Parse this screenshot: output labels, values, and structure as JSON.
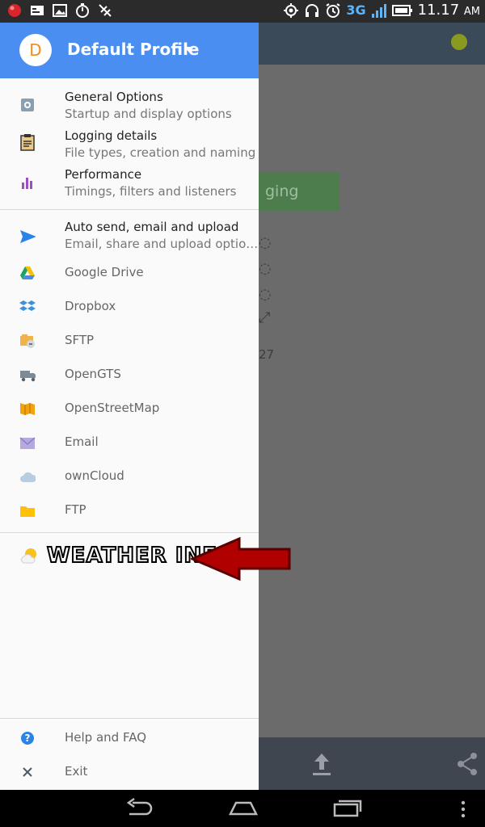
{
  "status_bar": {
    "network_label": "3G",
    "time": "11.17",
    "ampm": "AM"
  },
  "drawer": {
    "avatar_letter": "D",
    "profile_name": "Default Profile",
    "items_top": [
      {
        "title": "General Options",
        "subtitle": "Startup and display options",
        "icon": "gear-icon"
      },
      {
        "title": "Logging details",
        "subtitle": "File types, creation and naming",
        "icon": "clipboard-icon"
      },
      {
        "title": "Performance",
        "subtitle": "Timings, filters and listeners",
        "icon": "bar-chart-icon"
      }
    ],
    "auto_send": {
      "title": "Auto send, email and upload",
      "subtitle": "Email, share and upload optio…"
    },
    "services": [
      {
        "label": "Google Drive",
        "icon": "google-drive-icon"
      },
      {
        "label": "Dropbox",
        "icon": "dropbox-icon"
      },
      {
        "label": "SFTP",
        "icon": "sftp-icon"
      },
      {
        "label": "OpenGTS",
        "icon": "truck-icon"
      },
      {
        "label": "OpenStreetMap",
        "icon": "map-icon"
      },
      {
        "label": "Email",
        "icon": "envelope-icon"
      },
      {
        "label": "ownCloud",
        "icon": "cloud-icon"
      },
      {
        "label": "FTP",
        "icon": "folder-icon"
      }
    ],
    "weather_label": "WEATHER INFO",
    "help": "Help and FAQ",
    "exit": "Exit"
  },
  "background": {
    "green_button_text": "ging",
    "partial_number": "27"
  },
  "colors": {
    "header_blue": "#4a8ef2",
    "avatar_orange": "#f28a1e",
    "arrow_red": "#b00000"
  }
}
